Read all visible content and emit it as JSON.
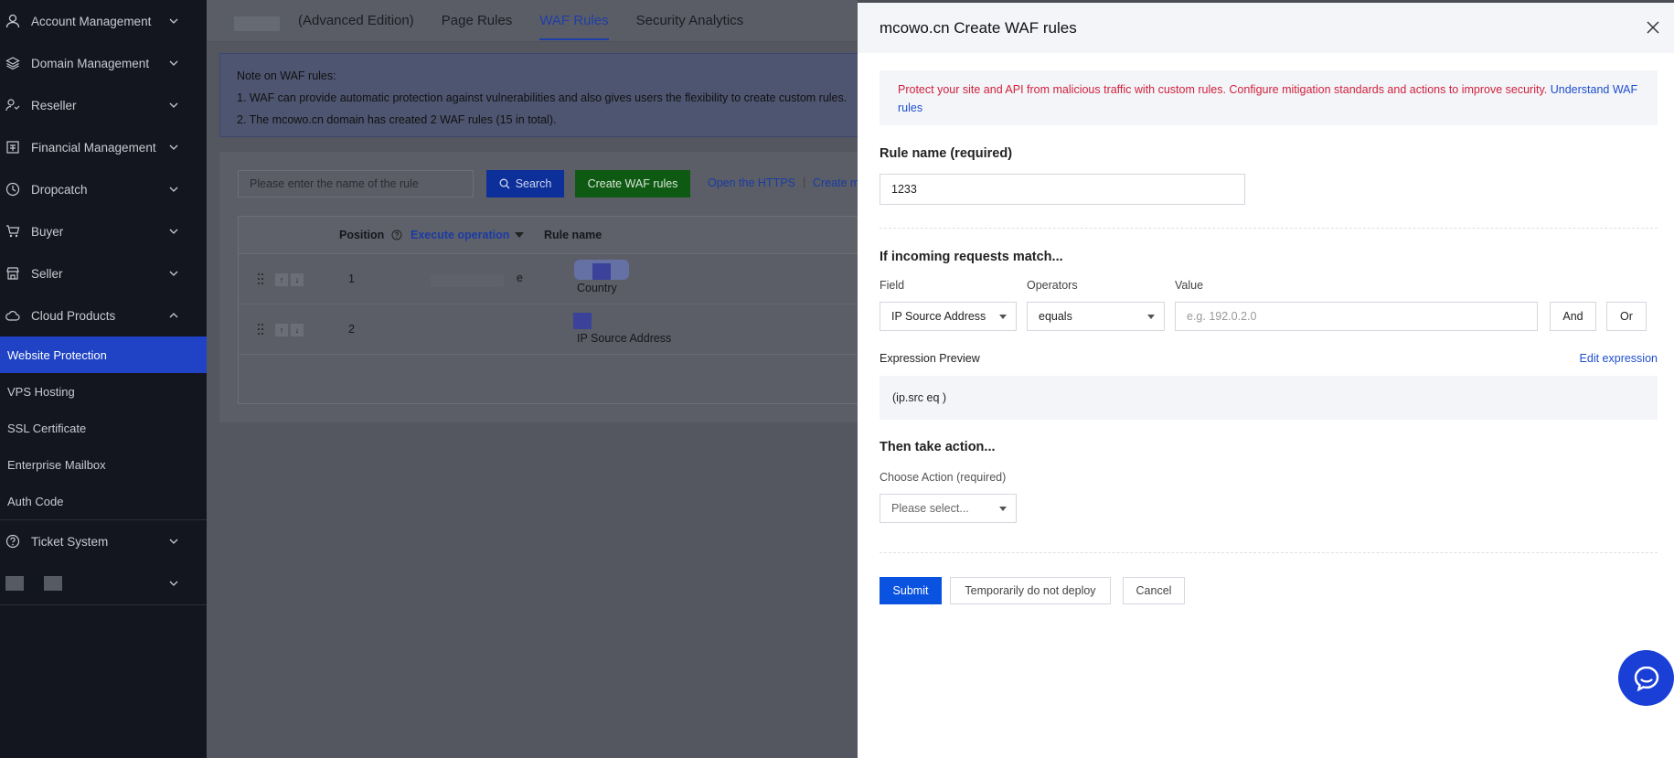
{
  "sidebar": {
    "items": [
      {
        "label": "Account Management",
        "icon": "user-icon"
      },
      {
        "label": "Domain Management",
        "icon": "layers-icon"
      },
      {
        "label": "Reseller",
        "icon": "reseller-icon"
      },
      {
        "label": "Financial Management",
        "icon": "finance-icon"
      },
      {
        "label": "Dropcatch",
        "icon": "clock-icon"
      },
      {
        "label": "Buyer",
        "icon": "cart-icon"
      },
      {
        "label": "Seller",
        "icon": "store-icon"
      },
      {
        "label": "Cloud Products",
        "icon": "cloud-icon"
      }
    ],
    "cloud_sub": [
      "Website Protection",
      "VPS Hosting",
      "SSL Certificate",
      "Enterprise Mailbox",
      "Auth Code"
    ],
    "ticket": {
      "label": "Ticket System",
      "icon": "help-icon"
    }
  },
  "tabs": {
    "advanced": "(Advanced Edition)",
    "page_rules": "Page Rules",
    "waf_rules": "WAF Rules",
    "security_analytics": "Security Analytics"
  },
  "note": {
    "title": "Note on WAF rules:",
    "line1": "1. WAF can provide automatic protection against vulnerabilities and also gives users the flexibility to create custom rules.",
    "line2": "2. The mcowo.cn domain has created 2 WAF rules (15 in total)."
  },
  "toolbar": {
    "search_placeholder": "Please enter the name of the rule",
    "search_label": "Search",
    "create_label": "Create WAF rules",
    "open_https": "Open the HTTPS",
    "sep": "|",
    "create_more": "Create m"
  },
  "table": {
    "headers": {
      "position": "Position",
      "execute": "Execute operation",
      "rule_name": "Rule name"
    },
    "rows": [
      {
        "position": "1",
        "rule_name": "Country",
        "exec_tail": "e"
      },
      {
        "position": "2",
        "rule_name": "IP Source Address"
      }
    ]
  },
  "drawer": {
    "title": "mcowo.cn Create WAF rules",
    "alert_text": "Protect your site and API from malicious traffic with custom rules. Configure mitigation standards and actions to improve security.",
    "alert_link": "Understand WAF rules",
    "rule_name_title": "Rule name (required)",
    "rule_name_value": "1233",
    "match_title": "If incoming requests match...",
    "field_label": "Field",
    "operators_label": "Operators",
    "value_label": "Value",
    "field_value": "IP Source Address",
    "operator_value": "equals",
    "value_placeholder": "e.g. 192.0.2.0",
    "and_label": "And",
    "or_label": "Or",
    "expr_preview_label": "Expression Preview",
    "edit_expression": "Edit expression",
    "expression": "(ip.src eq )",
    "action_title": "Then take action...",
    "action_label": "Choose Action (required)",
    "action_placeholder": "Please select...",
    "submit": "Submit",
    "not_deploy": "Temporarily do not deploy",
    "cancel": "Cancel"
  },
  "colors": {
    "accent": "#0a52e0",
    "sidebar_active": "#1f43c4",
    "alert_text": "#d1213c",
    "create_btn": "#0f5a12"
  }
}
